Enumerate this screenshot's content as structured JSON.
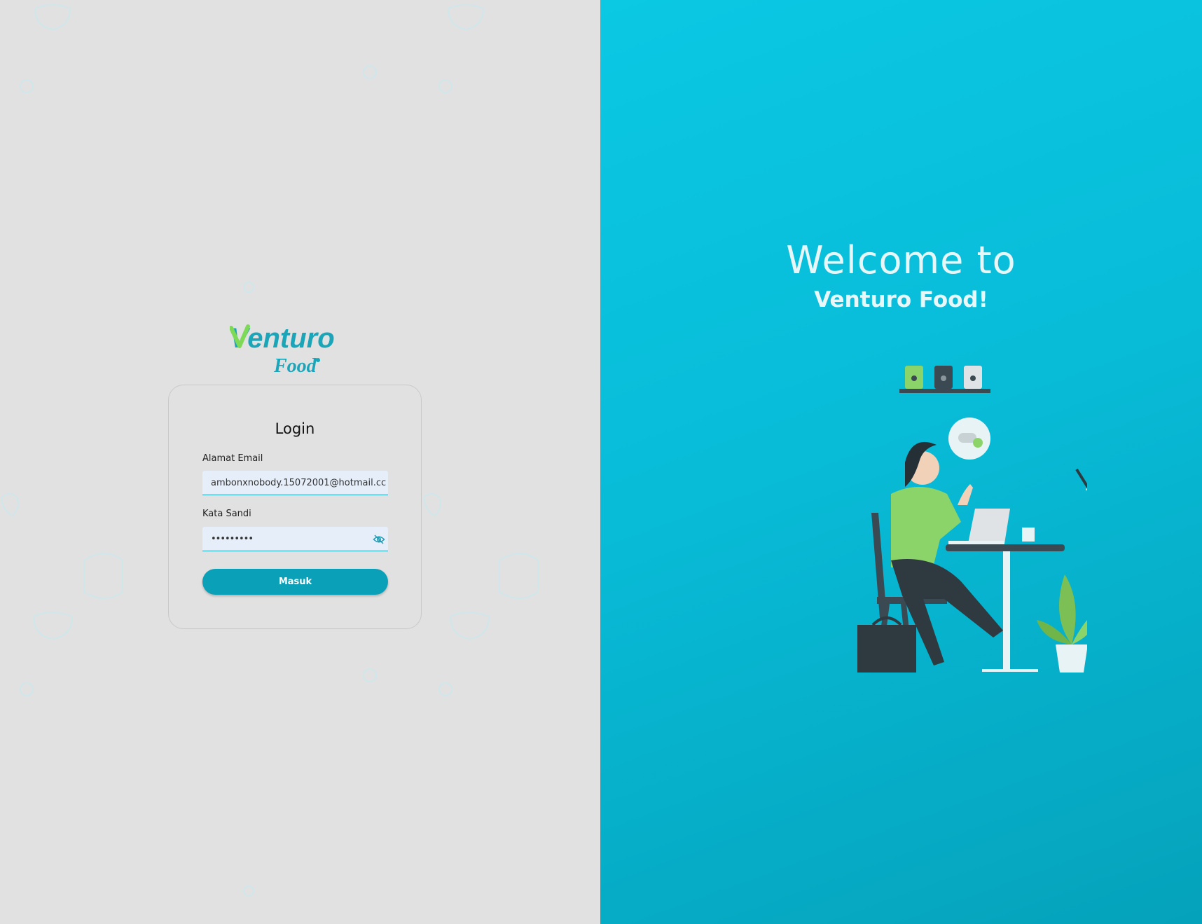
{
  "brand": {
    "logo_word": "Venturo",
    "logo_sub": "Food"
  },
  "login": {
    "title": "Login",
    "email_label": "Alamat Email",
    "email_value": "ambonxnobody.15072001@hotmail.cc",
    "password_label": "Kata Sandi",
    "password_value": "•••••••••",
    "password_toggle_icon": "eye-off-icon",
    "submit_label": "Masuk"
  },
  "hero": {
    "line1": "Welcome to",
    "line2": "Venturo Food!",
    "bubble_text": "?"
  },
  "colors": {
    "left_bg": "#e1e1e1",
    "right_bg": "#08bcd8",
    "accent": "#0aa0b8",
    "input_bg": "#e6eefa",
    "logo_teal": "#1aa5b8",
    "logo_green": "#7ed957"
  }
}
